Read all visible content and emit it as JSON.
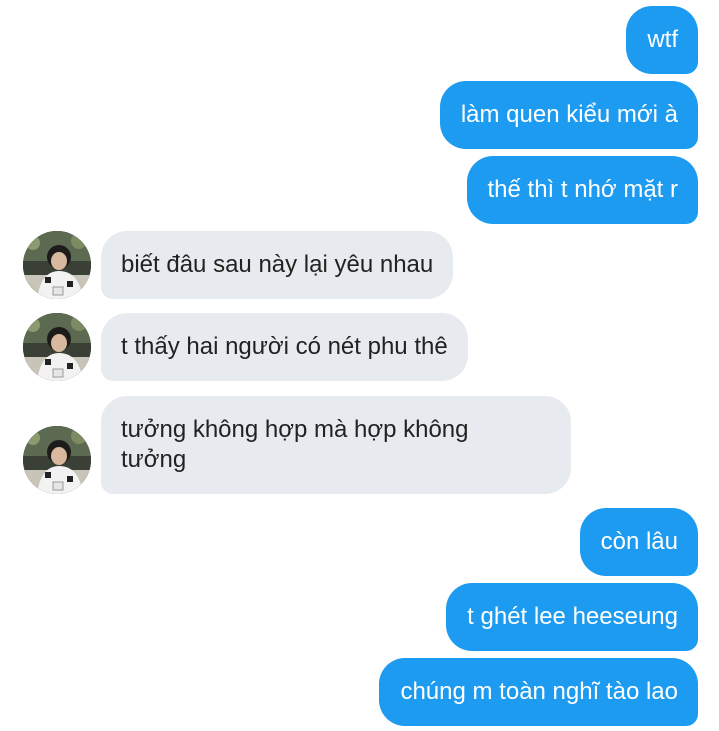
{
  "messages": [
    {
      "side": "out",
      "text": "wtf"
    },
    {
      "side": "out",
      "text": "làm quen kiểu mới à"
    },
    {
      "side": "out",
      "text": "thế thì t nhớ mặt r"
    },
    {
      "side": "in",
      "text": "biết đâu sau này lại yêu nhau"
    },
    {
      "side": "in",
      "text": "t thấy hai người có nét phu thê"
    },
    {
      "side": "in",
      "text": "tưởng không hợp mà hợp không tưởng"
    },
    {
      "side": "out",
      "text": "còn lâu"
    },
    {
      "side": "out",
      "text": "t ghét lee heeseung"
    },
    {
      "side": "out",
      "text": "chúng m toàn nghĩ tào lao"
    }
  ],
  "colors": {
    "outgoing_bubble": "#1d9bf0",
    "incoming_bubble": "#e7ebef",
    "background": "#ffffff"
  },
  "icons": {
    "avatar": "contact-avatar-icon"
  }
}
